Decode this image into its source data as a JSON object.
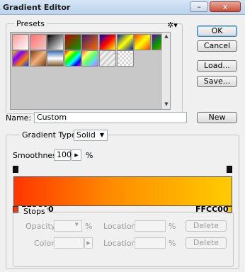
{
  "window": {
    "title": "Gradient Editor",
    "minimize_label": "–",
    "close_label": "x"
  },
  "presets": {
    "label": "Presets",
    "gear_icon": "gear-icon",
    "swatches_row1": [
      {
        "name": "foreground-to-background",
        "bg": "linear-gradient(135deg,#ff9a9a,#ffffff)"
      },
      {
        "name": "foreground-to-transparent",
        "bg": "linear-gradient(135deg,#ff6f6f,#f2c8c8)"
      },
      {
        "name": "black-to-white",
        "bg": "linear-gradient(135deg,#000000,#ffffff)"
      },
      {
        "name": "red-green",
        "bg": "linear-gradient(135deg,#c00000,#00a000)"
      },
      {
        "name": "violet-orange",
        "bg": "linear-gradient(135deg,#3a1a6e,#ff6a00)"
      },
      {
        "name": "blue-red-yellow",
        "bg": "linear-gradient(135deg,#0000c0,#ff0000,#ffff00)"
      },
      {
        "name": "blue-yellow-blue",
        "bg": "linear-gradient(135deg,#0020a0,#ffff00,#0020a0)"
      },
      {
        "name": "orange-yellow-orange",
        "bg": "linear-gradient(135deg,#ff4000,#ffff00,#ff4000)"
      },
      {
        "name": "violet-green-orange",
        "bg": "linear-gradient(135deg,#6a00a0,#00a000,#ff8000)"
      }
    ],
    "swatches_row2": [
      {
        "name": "yellow-violet-orange-blue",
        "bg": "linear-gradient(135deg,#ffd000,#8000ff,#ff8000,#0040ff)"
      },
      {
        "name": "copper",
        "bg": "linear-gradient(135deg,#7a3a10,#f2b07a,#7a3a10)"
      },
      {
        "name": "chrome",
        "bg": "linear-gradient(180deg,#3a6fb6,#ffffff 50%,#7a5a2a)"
      },
      {
        "name": "spectrum",
        "bg": "linear-gradient(135deg,#ff0000,#ffff00,#00ff00,#00ffff,#0000ff,#ff00ff)"
      },
      {
        "name": "transparent-rainbow",
        "bg": "linear-gradient(135deg,#ff5050,#ffff66,#66ff66,#66ccff,#cc66ff)"
      },
      {
        "name": "transparent-stripes",
        "bg": "repeating-linear-gradient(135deg,#f0f0f0 0 3px,#d0d0d0 3px 6px)"
      },
      {
        "name": "checker-transparent",
        "bg": "repeating-conic-gradient(#d6d6d6 0 25%,#ffffff 0 50%) 0 0/6px 6px"
      }
    ]
  },
  "buttons": {
    "ok": "OK",
    "cancel": "Cancel",
    "load": "Load...",
    "save": "Save...",
    "new": "New"
  },
  "name": {
    "label": "Name:",
    "value": "Custom"
  },
  "gradient": {
    "type_label": "Gradient Type:",
    "type_value": "Solid",
    "smoothness_label": "Smoothness:",
    "smoothness_value": "100",
    "smoothness_unit": "%",
    "start_color_label": "FF3600",
    "end_color_label": "FFCC00",
    "colors": {
      "start": "#FF3600",
      "end": "#FFCC00"
    }
  },
  "stops": {
    "label": "Stops",
    "opacity_label": "Opacity:",
    "opacity_unit": "%",
    "location_label_1": "Location:",
    "location_unit_1": "%",
    "delete_1": "Delete",
    "color_label": "Color:",
    "location_label_2": "Location:",
    "location_unit_2": "%",
    "delete_2": "Delete"
  }
}
